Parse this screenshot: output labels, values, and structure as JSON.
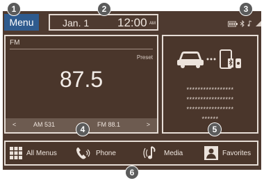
{
  "callouts": [
    "1",
    "2",
    "3",
    "4",
    "5",
    "6"
  ],
  "menu": {
    "label": "Menu"
  },
  "top": {
    "date": "Jan. 1",
    "time": "12:00",
    "ampm": "AM"
  },
  "status": {
    "icons": [
      "battery-icon",
      "bluetooth-icon",
      "music-icon",
      "signal-icon"
    ]
  },
  "radio": {
    "band": "FM",
    "preset_label": "Preset",
    "frequency": "87.5",
    "prev_arrow": "<",
    "next_arrow": ">",
    "prev_station": "AM 531",
    "next_station": "FM 88.1"
  },
  "phone_panel": {
    "lines": [
      "*****************",
      "*****************",
      "*****************",
      "******"
    ]
  },
  "dock": {
    "all_menus": "All Menus",
    "phone": "Phone",
    "media": "Media",
    "favorites": "Favorites"
  },
  "colors": {
    "background": "#4e3a30",
    "menu": "#2f5b8e",
    "border": "#e6ddd6"
  }
}
